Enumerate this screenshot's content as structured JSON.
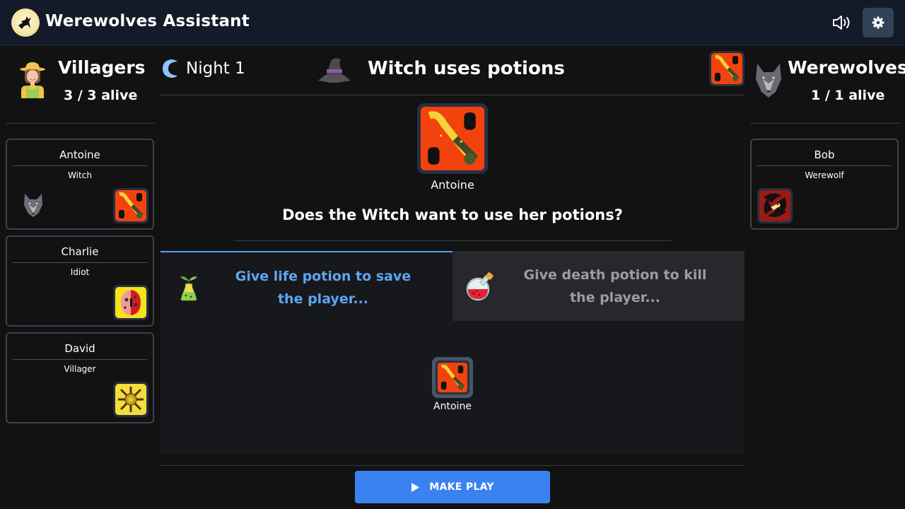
{
  "app": {
    "title": "Werewolves Assistant",
    "logo_icon": "howling-wolf-moon-icon",
    "sound_icon": "volume-icon",
    "settings_icon": "gear-icon"
  },
  "villagers": {
    "title": "Villagers",
    "alive": "3 / 3 alive",
    "icon": "farmer-avatar-icon",
    "players": [
      {
        "name": "Antoine",
        "role": "Witch",
        "attribute_icon": "werewolf-eaten-icon",
        "role_art": "witch-card"
      },
      {
        "name": "Charlie",
        "role": "Idiot",
        "role_art": "idiot-card"
      },
      {
        "name": "David",
        "role": "Villager",
        "role_art": "villager-card"
      }
    ]
  },
  "werewolves": {
    "title": "Werewolves",
    "alive": "1 / 1 alive",
    "icon": "wolf-head-icon",
    "players": [
      {
        "name": "Bob",
        "role": "Werewolf",
        "role_art": "werewolf-card"
      }
    ]
  },
  "game": {
    "phase_icon": "moon-icon",
    "phase": "Night 1",
    "turn_icon": "witch-hat-icon",
    "turn_title": "Witch uses potions",
    "current_role_art": "witch-card",
    "current_player": "Antoine",
    "question": "Does the Witch want to use her potions?",
    "tabs": [
      {
        "label": "Give life potion to save the player...",
        "icon": "life-potion-icon",
        "active": true
      },
      {
        "label": "Give death potion to kill the player...",
        "icon": "death-potion-icon",
        "active": false
      }
    ],
    "target": {
      "name": "Antoine",
      "role_art": "witch-card"
    },
    "make_play_label": "MAKE PLAY",
    "make_play_icon": "play-icon"
  },
  "colors": {
    "accent": "#3b82f0",
    "active_tab": "#5ea6f0",
    "topbar": "#131a29",
    "background": "#121212"
  }
}
